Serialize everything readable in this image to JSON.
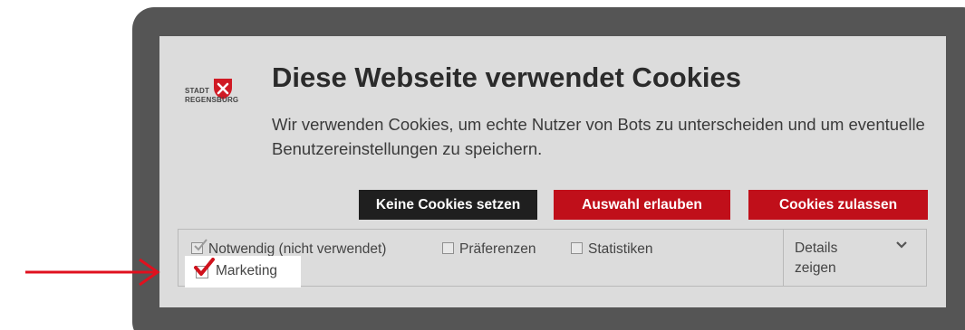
{
  "logo": {
    "line1": "STADT",
    "line2": "REGENSBURG"
  },
  "dialog": {
    "title": "Diese Webseite verwendet Cookies",
    "body": "Wir verwenden Cookies, um echte Nutzer von Bots zu unterscheiden und um eventuelle Benutzereinstellungen zu speichern."
  },
  "buttons": {
    "no_cookies": "Keine Cookies setzen",
    "allow_selection": "Auswahl erlauben",
    "allow_all": "Cookies zulassen"
  },
  "options": {
    "necessary": {
      "label": "Notwendig (nicht verwendet)",
      "checked": true,
      "disabled": true
    },
    "preferences": {
      "label": "Präferenzen",
      "checked": false
    },
    "statistics": {
      "label": "Statistiken",
      "checked": false
    },
    "marketing": {
      "label": "Marketing",
      "checked": true
    }
  },
  "details": {
    "label_line1": "Details",
    "label_line2": "zeigen",
    "icon": "chevron-down-icon"
  },
  "colors": {
    "frame": "#555555",
    "dialog_bg": "#dcdcdc",
    "brand_red": "#c00f1a",
    "dark_button": "#1f1f1f",
    "annotation_arrow": "#e0101e"
  }
}
